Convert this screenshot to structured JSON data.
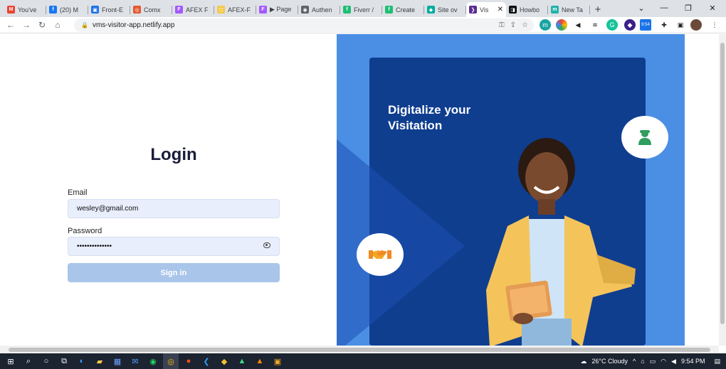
{
  "browser": {
    "tabs": [
      {
        "label": "You've",
        "color": "#ea4335",
        "glyph": "M"
      },
      {
        "label": "(20) M",
        "color": "#1877f2",
        "glyph": "f"
      },
      {
        "label": "Front-E",
        "color": "#1a73e8",
        "glyph": "▣"
      },
      {
        "label": "Comx",
        "color": "#e4572e",
        "glyph": "◎"
      },
      {
        "label": "AFEX F",
        "color": "#a259ff",
        "glyph": "F"
      },
      {
        "label": "AFEX-F",
        "color": "#f2c94c",
        "glyph": "☐"
      },
      {
        "label": "▶ Page",
        "color": "#a259ff",
        "glyph": "F"
      },
      {
        "label": "Authen",
        "color": "#5f6368",
        "glyph": "◉"
      },
      {
        "label": "Fiverr /",
        "color": "#1dbf73",
        "glyph": "f"
      },
      {
        "label": "Create",
        "color": "#1dbf73",
        "glyph": "f"
      },
      {
        "label": "Site ov",
        "color": "#00ad9f",
        "glyph": "◆"
      },
      {
        "label": "Vis",
        "color": "#5b2e91",
        "glyph": "❯",
        "active": true
      },
      {
        "label": "Howbo",
        "color": "#0b0c0f",
        "glyph": "◨"
      },
      {
        "label": "New Ta",
        "color": "#20b2aa",
        "glyph": "m"
      }
    ],
    "new_tab": "+",
    "url": "vms-visitor-app.netlify.app",
    "ext_badge": "9:54"
  },
  "login": {
    "title": "Login",
    "email_label": "Email",
    "email_value": "wesley@gmail.com",
    "password_label": "Password",
    "password_value": "••••••••••••••",
    "signin_label": "Sign in"
  },
  "hero": {
    "headline_line1": "Digitalize your",
    "headline_line2": "Visitation"
  },
  "taskbar": {
    "weather": "26°C  Cloudy",
    "time": "9:54 PM"
  },
  "colors": {
    "accent": "#a9c5ea",
    "hero_bg": "#4b8fe4",
    "hero_card": "#0f3e8f",
    "jacket": "#f4c45a"
  }
}
